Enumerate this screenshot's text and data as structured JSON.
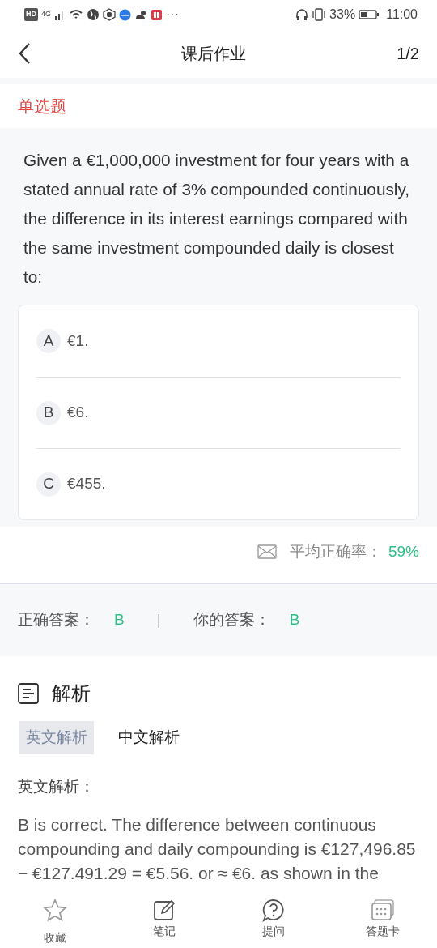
{
  "status_bar": {
    "hd": "HD",
    "network": "4G",
    "more": "···",
    "battery": "33%",
    "time": "11:00"
  },
  "header": {
    "title": "课后作业",
    "page": "1/2"
  },
  "question": {
    "type": "单选题",
    "text": "Given a €1,000,000 investment for four years with a stated annual rate of 3% compounded continuously, the difference in its interest earnings compared with the same investment compounded daily is closest to:",
    "options": [
      {
        "letter": "A",
        "text": "€1."
      },
      {
        "letter": "B",
        "text": "€6."
      },
      {
        "letter": "C",
        "text": "€455."
      }
    ]
  },
  "stats": {
    "label": "平均正确率：",
    "value": "59%"
  },
  "answers": {
    "correct_label": "正确答案：",
    "correct": "B",
    "separator": "|",
    "yours_label": "你的答案：",
    "yours": "B"
  },
  "analysis": {
    "title": "解析",
    "tabs": [
      {
        "label": "英文解析",
        "selected": true
      },
      {
        "label": "中文解析",
        "selected": false
      }
    ],
    "label": "英文解析：",
    "text": "B is correct. The difference between continuous compounding and daily compounding is €127,496.85 − €127.491.29 = €5.56. or ≈ €6. as shown in the"
  },
  "bottom_bar": [
    {
      "kind": "star",
      "label": "收藏"
    },
    {
      "kind": "note",
      "label": "笔记"
    },
    {
      "kind": "question",
      "label": "提问"
    },
    {
      "kind": "card",
      "label": "答题卡"
    }
  ]
}
